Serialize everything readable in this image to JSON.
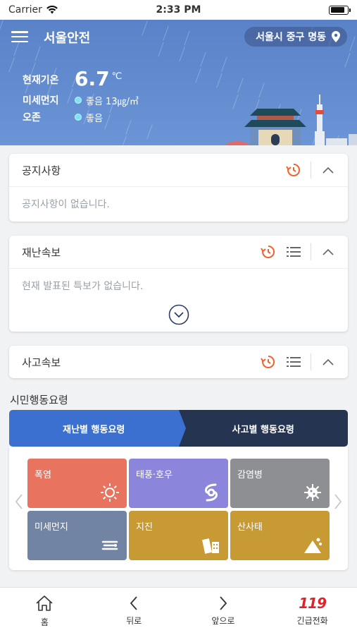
{
  "status_bar": {
    "carrier": "Carrier",
    "time": "2:33 PM",
    "battery_level": 0.85
  },
  "header": {
    "title": "서울안전",
    "location": "서울시 중구 명동",
    "weather": {
      "temp_label": "현재기온",
      "temp_value": "6.7",
      "temp_unit": "℃",
      "dust_label": "미세먼지",
      "dust_value": "좋음 13㎍/㎥",
      "ozone_label": "오존",
      "ozone_value": "좋음"
    }
  },
  "cards": {
    "notice": {
      "title": "공지사항",
      "body": "공지사항이 없습니다."
    },
    "disaster": {
      "title": "재난속보",
      "body": "현재 발표된 특보가 없습니다."
    },
    "accident": {
      "title": "사고속보"
    }
  },
  "citizen_guide": {
    "title": "시민행동요령",
    "tabs": [
      "재난별 행동요령",
      "사고별 행동요령"
    ],
    "active_tab": 0,
    "tiles": [
      {
        "label": "폭염",
        "color": "#e8745f",
        "icon": "sun-icon"
      },
      {
        "label": "태풍·호우",
        "color": "#8b86db",
        "icon": "typhoon-icon"
      },
      {
        "label": "감염병",
        "color": "#8d8f93",
        "icon": "virus-icon"
      },
      {
        "label": "미세먼지",
        "color": "#7284a4",
        "icon": "dust-icon"
      },
      {
        "label": "지진",
        "color": "#c89a34",
        "icon": "earthquake-icon"
      },
      {
        "label": "산사태",
        "color": "#c89a34",
        "icon": "landslide-icon"
      }
    ]
  },
  "bottom_nav": {
    "home": "홈",
    "back": "뒤로",
    "forward": "앞으로",
    "emergency": "긴급전화",
    "emergency_logo": "119"
  },
  "colors": {
    "accent": "#3b70d0",
    "navy": "#253451",
    "refresh": "#f0622d"
  }
}
